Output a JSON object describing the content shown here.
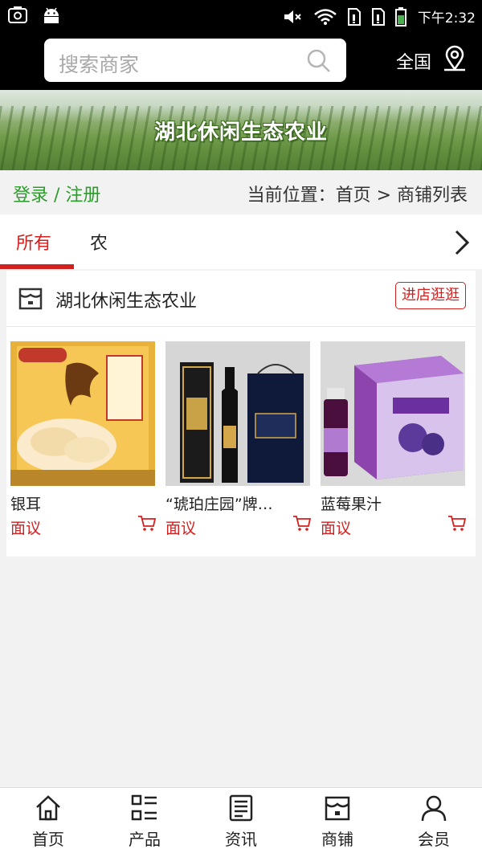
{
  "status_bar": {
    "time": "下午2:32",
    "icons": [
      "screenshot-icon",
      "android-icon",
      "mute-icon",
      "wifi-icon",
      "sim1-icon",
      "sim2-icon",
      "battery-icon"
    ]
  },
  "header": {
    "search_placeholder": "搜索商家",
    "region_label": "全国"
  },
  "banner": {
    "title": "湖北休闲生态农业"
  },
  "subheader": {
    "login_register": "登录 / 注册",
    "breadcrumb": "当前位置：首页 > 商铺列表"
  },
  "tabs": {
    "items": [
      {
        "label": "所有",
        "active": true
      },
      {
        "label": "农",
        "active": false
      }
    ]
  },
  "shop": {
    "name": "湖北休闲生态农业",
    "visit_button": "进店逛逛",
    "products": [
      {
        "name": "银耳",
        "price": "面议"
      },
      {
        "name": "“琥珀庄园”牌…",
        "price": "面议"
      },
      {
        "name": "蓝莓果汁",
        "price": "面议"
      }
    ]
  },
  "bottom_nav": {
    "items": [
      {
        "label": "首页",
        "icon": "home-icon"
      },
      {
        "label": "产品",
        "icon": "product-list-icon"
      },
      {
        "label": "资讯",
        "icon": "news-icon"
      },
      {
        "label": "商铺",
        "icon": "shop-icon"
      },
      {
        "label": "会员",
        "icon": "member-icon"
      }
    ]
  },
  "colors": {
    "accent_red": "#d41f1f",
    "login_green": "#2d9c2d",
    "header_black": "#000000"
  }
}
